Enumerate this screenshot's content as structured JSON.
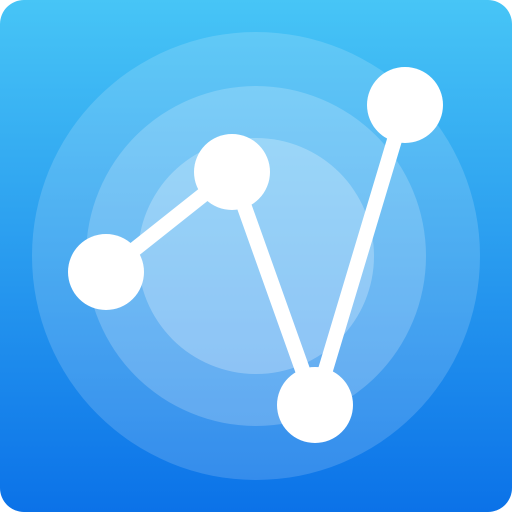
{
  "icon": {
    "name": "line-chart-nodes-app-icon",
    "background_gradient": [
      "#47c5f6",
      "#0b72e8"
    ],
    "ring_colors": [
      "#7dcdf7",
      "#9fd7f9",
      "#c4e6fb"
    ],
    "node_color": "#ffffff",
    "line_color": "#ffffff"
  }
}
